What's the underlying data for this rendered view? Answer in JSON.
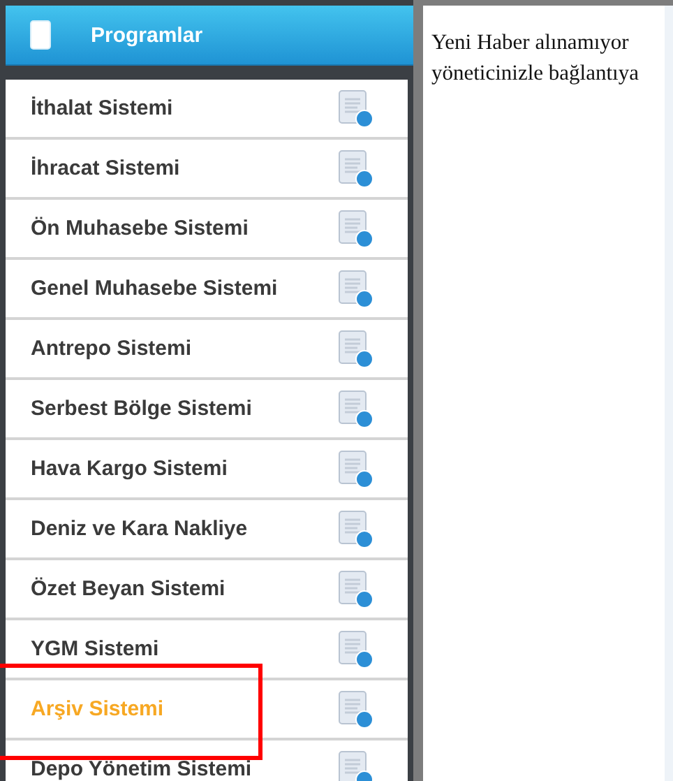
{
  "sidebar": {
    "title": "Programlar",
    "items": [
      {
        "label": "İthalat Sistemi",
        "selected": false
      },
      {
        "label": "İhracat Sistemi",
        "selected": false
      },
      {
        "label": "Ön Muhasebe Sistemi",
        "selected": false
      },
      {
        "label": "Genel Muhasebe Sistemi",
        "selected": false
      },
      {
        "label": "Antrepo Sistemi",
        "selected": false
      },
      {
        "label": "Serbest Bölge Sistemi",
        "selected": false
      },
      {
        "label": "Hava Kargo Sistemi",
        "selected": false
      },
      {
        "label": "Deniz ve Kara Nakliye",
        "selected": false
      },
      {
        "label": "Özet Beyan Sistemi",
        "selected": false
      },
      {
        "label": "YGM Sistemi",
        "selected": false
      },
      {
        "label": "Arşiv Sistemi",
        "selected": true
      },
      {
        "label": "Depo Yönetim Sistemi",
        "selected": false
      }
    ]
  },
  "content": {
    "lines": [
      "Yeni Haber alınamıyor",
      "yöneticinizle bağlantıya"
    ]
  }
}
